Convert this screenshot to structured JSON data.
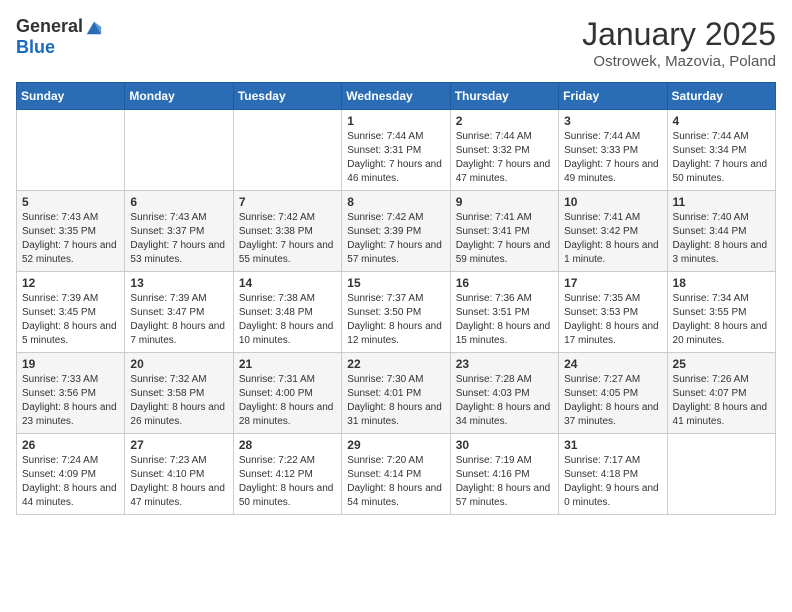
{
  "header": {
    "logo_general": "General",
    "logo_blue": "Blue",
    "month": "January 2025",
    "location": "Ostrowek, Mazovia, Poland"
  },
  "weekdays": [
    "Sunday",
    "Monday",
    "Tuesday",
    "Wednesday",
    "Thursday",
    "Friday",
    "Saturday"
  ],
  "weeks": [
    [
      {
        "day": "",
        "sunrise": "",
        "sunset": "",
        "daylight": ""
      },
      {
        "day": "",
        "sunrise": "",
        "sunset": "",
        "daylight": ""
      },
      {
        "day": "",
        "sunrise": "",
        "sunset": "",
        "daylight": ""
      },
      {
        "day": "1",
        "sunrise": "Sunrise: 7:44 AM",
        "sunset": "Sunset: 3:31 PM",
        "daylight": "Daylight: 7 hours and 46 minutes."
      },
      {
        "day": "2",
        "sunrise": "Sunrise: 7:44 AM",
        "sunset": "Sunset: 3:32 PM",
        "daylight": "Daylight: 7 hours and 47 minutes."
      },
      {
        "day": "3",
        "sunrise": "Sunrise: 7:44 AM",
        "sunset": "Sunset: 3:33 PM",
        "daylight": "Daylight: 7 hours and 49 minutes."
      },
      {
        "day": "4",
        "sunrise": "Sunrise: 7:44 AM",
        "sunset": "Sunset: 3:34 PM",
        "daylight": "Daylight: 7 hours and 50 minutes."
      }
    ],
    [
      {
        "day": "5",
        "sunrise": "Sunrise: 7:43 AM",
        "sunset": "Sunset: 3:35 PM",
        "daylight": "Daylight: 7 hours and 52 minutes."
      },
      {
        "day": "6",
        "sunrise": "Sunrise: 7:43 AM",
        "sunset": "Sunset: 3:37 PM",
        "daylight": "Daylight: 7 hours and 53 minutes."
      },
      {
        "day": "7",
        "sunrise": "Sunrise: 7:42 AM",
        "sunset": "Sunset: 3:38 PM",
        "daylight": "Daylight: 7 hours and 55 minutes."
      },
      {
        "day": "8",
        "sunrise": "Sunrise: 7:42 AM",
        "sunset": "Sunset: 3:39 PM",
        "daylight": "Daylight: 7 hours and 57 minutes."
      },
      {
        "day": "9",
        "sunrise": "Sunrise: 7:41 AM",
        "sunset": "Sunset: 3:41 PM",
        "daylight": "Daylight: 7 hours and 59 minutes."
      },
      {
        "day": "10",
        "sunrise": "Sunrise: 7:41 AM",
        "sunset": "Sunset: 3:42 PM",
        "daylight": "Daylight: 8 hours and 1 minute."
      },
      {
        "day": "11",
        "sunrise": "Sunrise: 7:40 AM",
        "sunset": "Sunset: 3:44 PM",
        "daylight": "Daylight: 8 hours and 3 minutes."
      }
    ],
    [
      {
        "day": "12",
        "sunrise": "Sunrise: 7:39 AM",
        "sunset": "Sunset: 3:45 PM",
        "daylight": "Daylight: 8 hours and 5 minutes."
      },
      {
        "day": "13",
        "sunrise": "Sunrise: 7:39 AM",
        "sunset": "Sunset: 3:47 PM",
        "daylight": "Daylight: 8 hours and 7 minutes."
      },
      {
        "day": "14",
        "sunrise": "Sunrise: 7:38 AM",
        "sunset": "Sunset: 3:48 PM",
        "daylight": "Daylight: 8 hours and 10 minutes."
      },
      {
        "day": "15",
        "sunrise": "Sunrise: 7:37 AM",
        "sunset": "Sunset: 3:50 PM",
        "daylight": "Daylight: 8 hours and 12 minutes."
      },
      {
        "day": "16",
        "sunrise": "Sunrise: 7:36 AM",
        "sunset": "Sunset: 3:51 PM",
        "daylight": "Daylight: 8 hours and 15 minutes."
      },
      {
        "day": "17",
        "sunrise": "Sunrise: 7:35 AM",
        "sunset": "Sunset: 3:53 PM",
        "daylight": "Daylight: 8 hours and 17 minutes."
      },
      {
        "day": "18",
        "sunrise": "Sunrise: 7:34 AM",
        "sunset": "Sunset: 3:55 PM",
        "daylight": "Daylight: 8 hours and 20 minutes."
      }
    ],
    [
      {
        "day": "19",
        "sunrise": "Sunrise: 7:33 AM",
        "sunset": "Sunset: 3:56 PM",
        "daylight": "Daylight: 8 hours and 23 minutes."
      },
      {
        "day": "20",
        "sunrise": "Sunrise: 7:32 AM",
        "sunset": "Sunset: 3:58 PM",
        "daylight": "Daylight: 8 hours and 26 minutes."
      },
      {
        "day": "21",
        "sunrise": "Sunrise: 7:31 AM",
        "sunset": "Sunset: 4:00 PM",
        "daylight": "Daylight: 8 hours and 28 minutes."
      },
      {
        "day": "22",
        "sunrise": "Sunrise: 7:30 AM",
        "sunset": "Sunset: 4:01 PM",
        "daylight": "Daylight: 8 hours and 31 minutes."
      },
      {
        "day": "23",
        "sunrise": "Sunrise: 7:28 AM",
        "sunset": "Sunset: 4:03 PM",
        "daylight": "Daylight: 8 hours and 34 minutes."
      },
      {
        "day": "24",
        "sunrise": "Sunrise: 7:27 AM",
        "sunset": "Sunset: 4:05 PM",
        "daylight": "Daylight: 8 hours and 37 minutes."
      },
      {
        "day": "25",
        "sunrise": "Sunrise: 7:26 AM",
        "sunset": "Sunset: 4:07 PM",
        "daylight": "Daylight: 8 hours and 41 minutes."
      }
    ],
    [
      {
        "day": "26",
        "sunrise": "Sunrise: 7:24 AM",
        "sunset": "Sunset: 4:09 PM",
        "daylight": "Daylight: 8 hours and 44 minutes."
      },
      {
        "day": "27",
        "sunrise": "Sunrise: 7:23 AM",
        "sunset": "Sunset: 4:10 PM",
        "daylight": "Daylight: 8 hours and 47 minutes."
      },
      {
        "day": "28",
        "sunrise": "Sunrise: 7:22 AM",
        "sunset": "Sunset: 4:12 PM",
        "daylight": "Daylight: 8 hours and 50 minutes."
      },
      {
        "day": "29",
        "sunrise": "Sunrise: 7:20 AM",
        "sunset": "Sunset: 4:14 PM",
        "daylight": "Daylight: 8 hours and 54 minutes."
      },
      {
        "day": "30",
        "sunrise": "Sunrise: 7:19 AM",
        "sunset": "Sunset: 4:16 PM",
        "daylight": "Daylight: 8 hours and 57 minutes."
      },
      {
        "day": "31",
        "sunrise": "Sunrise: 7:17 AM",
        "sunset": "Sunset: 4:18 PM",
        "daylight": "Daylight: 9 hours and 0 minutes."
      },
      {
        "day": "",
        "sunrise": "",
        "sunset": "",
        "daylight": ""
      }
    ]
  ]
}
